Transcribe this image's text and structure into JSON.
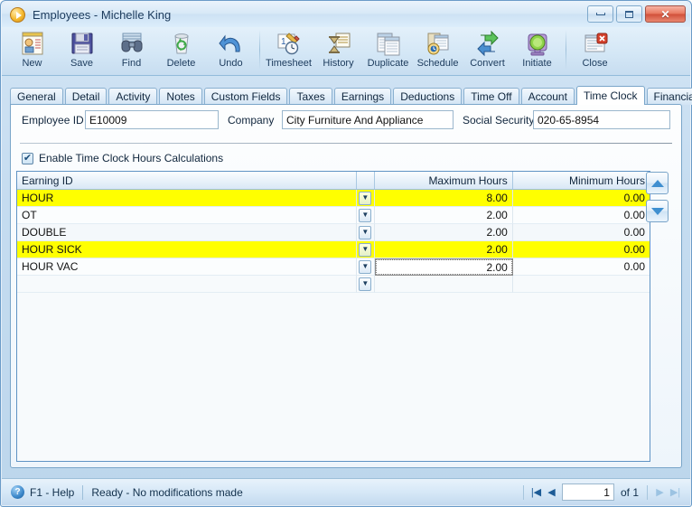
{
  "window": {
    "title": "Employees - Michelle King",
    "app_icon": "play-circle-icon",
    "minimize_label": "Minimize",
    "restore_label": "Restore",
    "close_label": "Close"
  },
  "toolbar": {
    "buttons": [
      {
        "label": "New",
        "icon": "new-record-icon"
      },
      {
        "label": "Save",
        "icon": "floppy-disk-icon"
      },
      {
        "label": "Find",
        "icon": "binoculars-icon"
      },
      {
        "label": "Delete",
        "icon": "recycle-bin-icon"
      },
      {
        "label": "Undo",
        "icon": "undo-arrow-icon"
      },
      {
        "label": "Timesheet",
        "icon": "timesheet-clock-icon"
      },
      {
        "label": "History",
        "icon": "hourglass-history-icon"
      },
      {
        "label": "Duplicate",
        "icon": "duplicate-pages-icon"
      },
      {
        "label": "Schedule",
        "icon": "schedule-calendar-icon"
      },
      {
        "label": "Convert",
        "icon": "convert-arrows-icon"
      },
      {
        "label": "Initiate",
        "icon": "initiate-light-icon"
      },
      {
        "label": "Close",
        "icon": "close-document-icon"
      }
    ]
  },
  "tabs": [
    {
      "label": "General",
      "active": false
    },
    {
      "label": "Detail",
      "active": false
    },
    {
      "label": "Activity",
      "active": false
    },
    {
      "label": "Notes",
      "active": false
    },
    {
      "label": "Custom Fields",
      "active": false
    },
    {
      "label": "Taxes",
      "active": false
    },
    {
      "label": "Earnings",
      "active": false
    },
    {
      "label": "Deductions",
      "active": false
    },
    {
      "label": "Time Off",
      "active": false
    },
    {
      "label": "Account",
      "active": false
    },
    {
      "label": "Time Clock",
      "active": true
    },
    {
      "label": "Financial Reports",
      "active": false
    }
  ],
  "form": {
    "employee_id_label": "Employee ID",
    "employee_id_value": "E10009",
    "company_label": "Company",
    "company_value": "City Furniture And Appliance",
    "social_security_label": "Social Security",
    "social_security_value": "020-65-8954",
    "enable_checkbox_label": "Enable Time Clock Hours Calculations",
    "enable_checkbox_checked": true,
    "checkbox_glyph": "✔"
  },
  "grid": {
    "columns": [
      "Earning ID",
      "",
      "Maximum Hours",
      "Minimum Hours"
    ],
    "dropdown_glyph": "▼",
    "rows": [
      {
        "earning_id": "HOUR",
        "maximum_hours": "8.00",
        "minimum_hours": "0.00",
        "highlighted": true,
        "editing": false
      },
      {
        "earning_id": "OT",
        "maximum_hours": "2.00",
        "minimum_hours": "0.00",
        "highlighted": false,
        "editing": false
      },
      {
        "earning_id": "DOUBLE",
        "maximum_hours": "2.00",
        "minimum_hours": "0.00",
        "highlighted": false,
        "editing": false
      },
      {
        "earning_id": "HOUR SICK",
        "maximum_hours": "2.00",
        "minimum_hours": "0.00",
        "highlighted": true,
        "editing": false
      },
      {
        "earning_id": "HOUR VAC",
        "maximum_hours": "2.00",
        "minimum_hours": "0.00",
        "highlighted": false,
        "editing": true
      },
      {
        "earning_id": "",
        "maximum_hours": "",
        "minimum_hours": "",
        "highlighted": false,
        "editing": false
      }
    ],
    "move_up_label": "Move Up",
    "move_down_label": "Move Down"
  },
  "statusbar": {
    "help_icon": "question-mark-icon",
    "help_text": "F1 - Help",
    "status_text": "Ready - No modifications made",
    "nav": {
      "first_glyph": "|◀",
      "prev_glyph": "◀",
      "page_value": "1",
      "of_text": "of 1",
      "next_glyph": "▶",
      "last_glyph": "▶|"
    }
  },
  "colors": {
    "highlight_row": "#ffff00",
    "title_text": "#1b3a5c",
    "window_border": "#6a9bc8",
    "grid_border": "#5f93c4",
    "close_button": "#d1503a"
  }
}
